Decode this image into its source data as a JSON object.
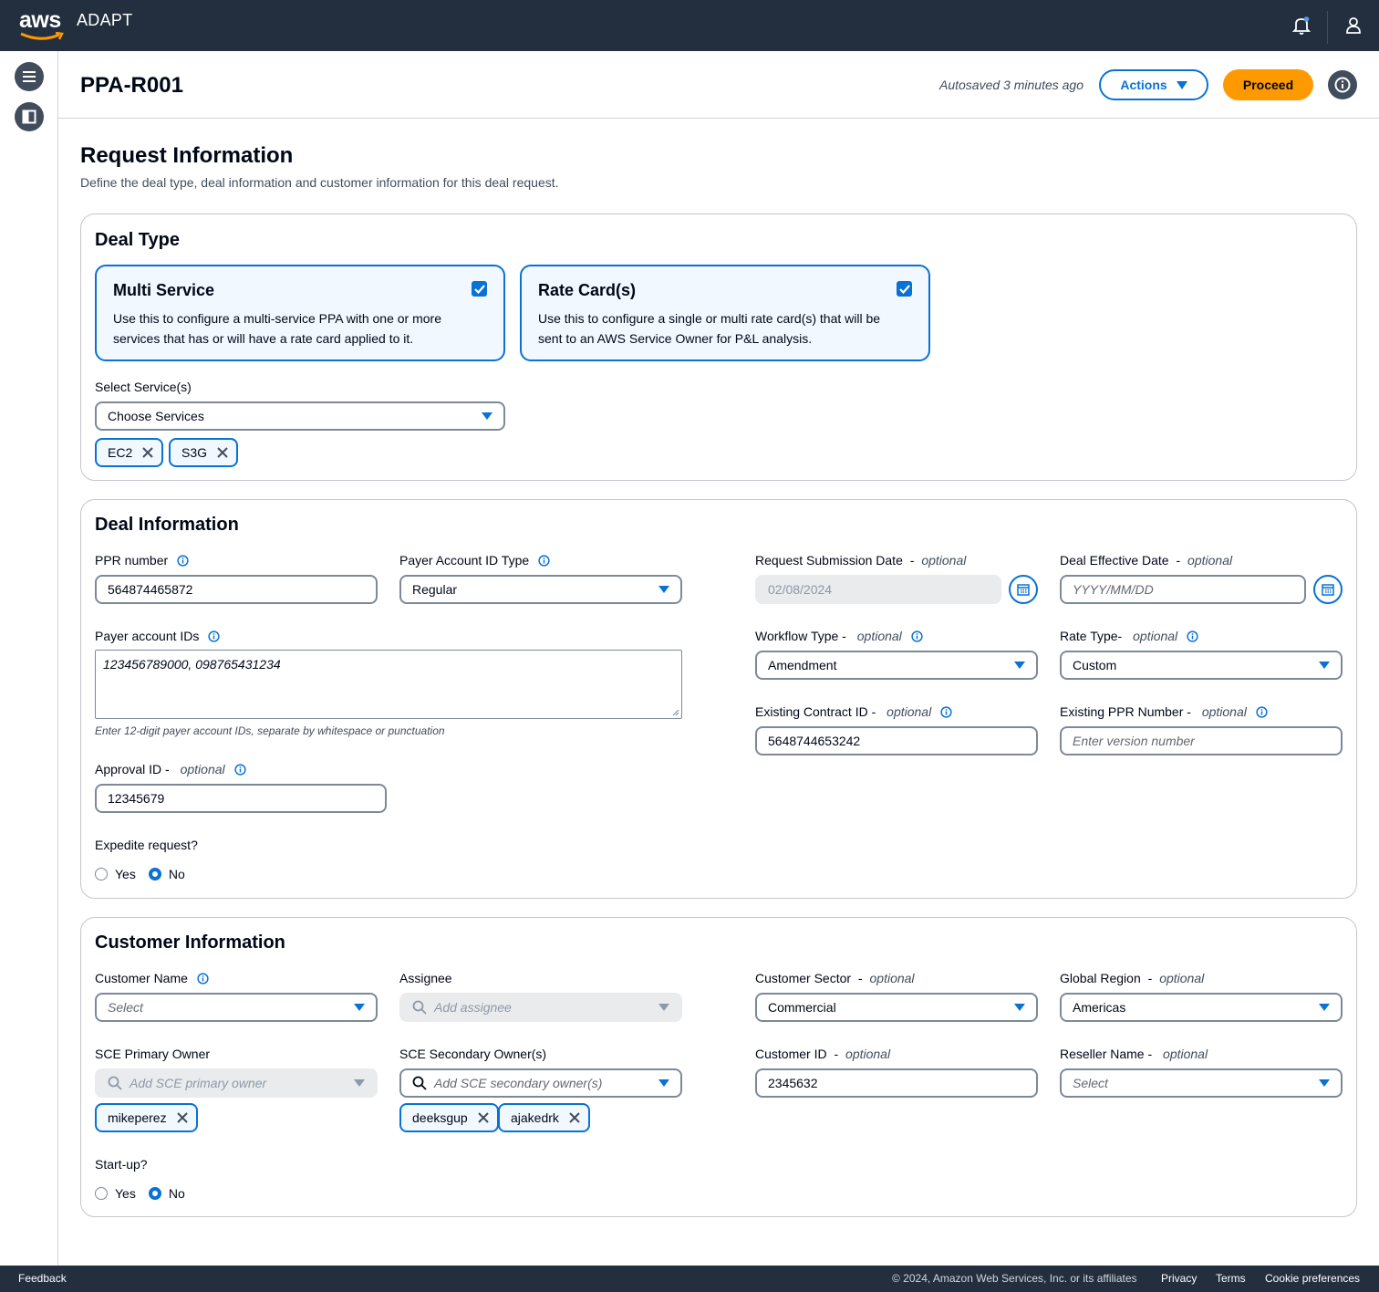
{
  "nav": {
    "logo_text": "aws",
    "app_name": "ADAPT",
    "icons": [
      "notification-bell-icon",
      "user-profile-icon"
    ]
  },
  "sidebar": {
    "icons": [
      "menu-icon",
      "panel-icon"
    ]
  },
  "header": {
    "title": "PPA-R001",
    "autosave": "Autosaved 3 minutes ago",
    "actions_label": "Actions",
    "proceed_label": "Proceed"
  },
  "page": {
    "title": "Request Information",
    "description": "Define the deal type, deal information and customer information for this deal request."
  },
  "deal_type": {
    "title": "Deal Type",
    "tiles": [
      {
        "title": "Multi Service",
        "description": "Use this to configure a multi-service PPA with one or more services that has or will have a rate card applied to it.",
        "checked": true
      },
      {
        "title": "Rate Card(s)",
        "description": "Use this to configure a single or multi rate card(s) that will be sent to an AWS Service Owner for P&L analysis.",
        "checked": true
      }
    ],
    "services_label": "Select Service(s)",
    "services_placeholder": "Choose Services",
    "selected_services": [
      "EC2",
      "S3G"
    ]
  },
  "deal_info": {
    "title": "Deal Information",
    "ppr_label": "PPR number",
    "ppr_value": "564874465872",
    "payer_type_label": "Payer Account ID Type",
    "payer_type_value": "Regular",
    "submission_date_label": "Request Submission Date",
    "submission_date_value": "02/08/2024",
    "effective_date_label": "Deal Effective Date",
    "effective_date_placeholder": "YYYY/MM/DD",
    "optional": "optional",
    "payer_ids_label": "Payer account IDs",
    "payer_ids_value": "123456789000, 098765431234",
    "payer_ids_hint": "Enter 12-digit payer account IDs, separate by whitespace or punctuation",
    "workflow_label": "Workflow Type -",
    "workflow_value": "Amendment",
    "rate_type_label": "Rate Type-",
    "rate_type_value": "Custom",
    "contract_id_label": "Existing Contract ID -",
    "contract_id_value": "5648744653242",
    "existing_ppr_label": "Existing PPR Number -",
    "existing_ppr_placeholder": "Enter version number",
    "approval_label": "Approval ID -",
    "approval_value": "12345679",
    "expedite_label": "Expedite request?",
    "yes": "Yes",
    "no": "No",
    "expedite_value": "No"
  },
  "customer_info": {
    "title": "Customer Information",
    "customer_name_label": "Customer Name",
    "customer_name_placeholder": "Select",
    "assignee_label": "Assignee",
    "assignee_placeholder": "Add assignee",
    "sector_label": "Customer Sector",
    "sector_value": "Commercial",
    "region_label": "Global Region",
    "region_value": "Americas",
    "sce_primary_label": "SCE Primary Owner",
    "sce_primary_placeholder": "Add SCE primary owner",
    "sce_primary_tokens": [
      "mikeperez"
    ],
    "sce_secondary_label": "SCE Secondary Owner(s)",
    "sce_secondary_placeholder": "Add SCE secondary owner(s)",
    "sce_secondary_tokens": [
      "deeksgup",
      "ajakedrk"
    ],
    "customer_id_label": "Customer ID",
    "customer_id_value": "2345632",
    "reseller_label": "Reseller Name -",
    "reseller_placeholder": "Select",
    "optional": "optional",
    "startup_label": "Start-up?",
    "yes": "Yes",
    "no": "No",
    "startup_value": "No"
  },
  "footer": {
    "feedback": "Feedback",
    "copyright": "© 2024, Amazon Web Services, Inc. or its affiliates",
    "links": [
      "Privacy",
      "Terms",
      "Cookie preferences"
    ]
  },
  "colors": {
    "nav_bg": "#232f3e",
    "accent": "#0972d3",
    "proceed": "#ff9900"
  }
}
